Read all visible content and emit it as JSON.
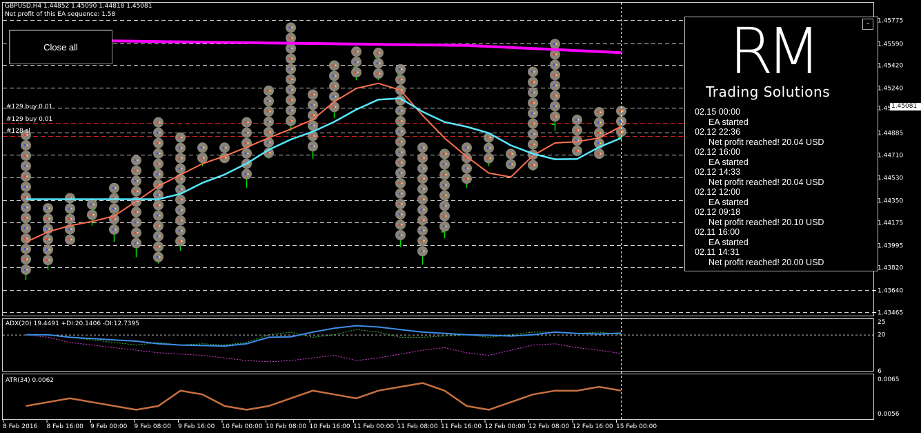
{
  "header": {
    "symbol_line": "GBPUSD,H4  1.44852 1.45090 1.44818 1.45081",
    "profit_line": "Net profit of this EA sequence: 1.58"
  },
  "buttons": {
    "close_all": "Close all",
    "minimize": "-"
  },
  "logo": {
    "initials": "RM",
    "subtitle": "Trading Solutions"
  },
  "event_log": [
    {
      "date": "02.15 00:00",
      "text": "EA started"
    },
    {
      "date": "02.12 22:36",
      "text": "Net profit reached!   20.04 USD"
    },
    {
      "date": "02.12 16:00",
      "text": "EA started"
    },
    {
      "date": "02.12 14:33",
      "text": "Net profit reached!   20.04 USD"
    },
    {
      "date": "02.12 12:00",
      "text": "EA started"
    },
    {
      "date": "02.12 09:18",
      "text": "Net profit reached!   20.10 USD"
    },
    {
      "date": "02.11 16:00",
      "text": "EA started"
    },
    {
      "date": "02.11 14:31",
      "text": "Net profit reached!   20.00 USD"
    }
  ],
  "order_labels": [
    "#129 buy 0.01",
    "#129 buy 0.01",
    "#128 sl"
  ],
  "price_axis": [
    "1.45775",
    "1.45590",
    "1.45420",
    "1.45240",
    "1.45081",
    "1.44885",
    "1.44710",
    "1.44530",
    "1.44350",
    "1.44175",
    "1.43995",
    "1.43820",
    "1.43640",
    "1.43465"
  ],
  "current_price": "1.45081",
  "indicators": {
    "adx_label": "ADX(20) 19.4491 +DI:20.1406 -DI:12.7395",
    "adx_axis": [
      "25",
      "20",
      "6"
    ],
    "atr_label": "ATR(34) 0.0062",
    "atr_axis": [
      "0.0065",
      "0.0056"
    ]
  },
  "time_axis": [
    "8 Feb 2016",
    "8 Feb 16:00",
    "9 Feb 00:00",
    "9 Feb 08:00",
    "9 Feb 16:00",
    "10 Feb 00:00",
    "10 Feb 08:00",
    "10 Feb 16:00",
    "11 Feb 00:00",
    "11 Feb 08:00",
    "11 Feb 16:00",
    "12 Feb 00:00",
    "12 Feb 08:00",
    "12 Feb 16:00",
    "15 Feb 00:00"
  ],
  "colors": {
    "candle": "#00e000",
    "ma_slow": "#ff00ff",
    "ma_fast": "#55e8ff",
    "ma_mid": "#ff7050",
    "adx_line": "#3d8ee8",
    "atr_line": "#c87040",
    "grid": "#d0d0d0"
  },
  "chart_data": {
    "type": "line",
    "symbol": "GBPUSD",
    "timeframe": "H4",
    "bars": [
      {
        "o": 1.4478,
        "h": 1.449,
        "l": 1.4372,
        "c": 1.4402
      },
      {
        "o": 1.4402,
        "h": 1.4432,
        "l": 1.438,
        "c": 1.4418
      },
      {
        "o": 1.4418,
        "h": 1.444,
        "l": 1.44,
        "c": 1.4425
      },
      {
        "o": 1.4425,
        "h": 1.4435,
        "l": 1.4415,
        "c": 1.4428
      },
      {
        "o": 1.4428,
        "h": 1.4448,
        "l": 1.4402,
        "c": 1.444
      },
      {
        "o": 1.444,
        "h": 1.447,
        "l": 1.439,
        "c": 1.446
      },
      {
        "o": 1.446,
        "h": 1.45,
        "l": 1.4385,
        "c": 1.4478
      },
      {
        "o": 1.4478,
        "h": 1.4488,
        "l": 1.4395,
        "c": 1.447
      },
      {
        "o": 1.447,
        "h": 1.448,
        "l": 1.4462,
        "c": 1.4472
      },
      {
        "o": 1.4472,
        "h": 1.448,
        "l": 1.4465,
        "c": 1.447
      },
      {
        "o": 1.447,
        "h": 1.45,
        "l": 1.4445,
        "c": 1.4495
      },
      {
        "o": 1.4495,
        "h": 1.4525,
        "l": 1.4468,
        "c": 1.4515
      },
      {
        "o": 1.4515,
        "h": 1.4575,
        "l": 1.449,
        "c": 1.4505
      },
      {
        "o": 1.4505,
        "h": 1.4522,
        "l": 1.4468,
        "c": 1.451
      },
      {
        "o": 1.451,
        "h": 1.4545,
        "l": 1.45,
        "c": 1.454
      },
      {
        "o": 1.454,
        "h": 1.4556,
        "l": 1.453,
        "c": 1.4548
      },
      {
        "o": 1.4548,
        "h": 1.4555,
        "l": 1.453,
        "c": 1.4535
      },
      {
        "o": 1.4535,
        "h": 1.4542,
        "l": 1.4398,
        "c": 1.4478
      },
      {
        "o": 1.4478,
        "h": 1.448,
        "l": 1.4384,
        "c": 1.441
      },
      {
        "o": 1.441,
        "h": 1.4475,
        "l": 1.4405,
        "c": 1.445
      },
      {
        "o": 1.445,
        "h": 1.448,
        "l": 1.4445,
        "c": 1.4475
      },
      {
        "o": 1.4475,
        "h": 1.4488,
        "l": 1.4462,
        "c": 1.447
      },
      {
        "o": 1.447,
        "h": 1.4475,
        "l": 1.446,
        "c": 1.4462
      },
      {
        "o": 1.4462,
        "h": 1.454,
        "l": 1.4458,
        "c": 1.4495
      },
      {
        "o": 1.4495,
        "h": 1.4562,
        "l": 1.449,
        "c": 1.45
      },
      {
        "o": 1.45,
        "h": 1.4502,
        "l": 1.447,
        "c": 1.448
      },
      {
        "o": 1.448,
        "h": 1.4508,
        "l": 1.4468,
        "c": 1.4485
      },
      {
        "o": 1.4485,
        "h": 1.4509,
        "l": 1.4482,
        "c": 1.4508
      }
    ],
    "ylim": [
      1.43465,
      1.4587
    ],
    "xlabel": "",
    "ylabel": ""
  }
}
